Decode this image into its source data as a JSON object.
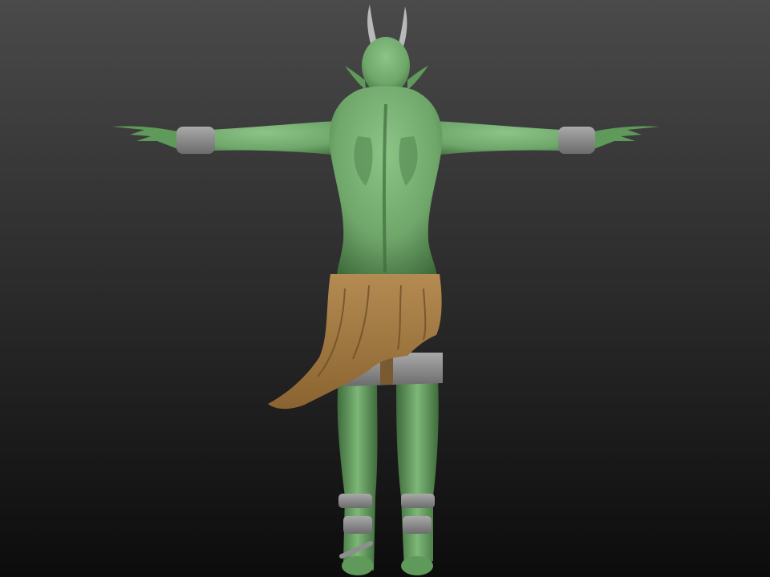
{
  "viewport": {
    "background_top": "#4a4a4a",
    "background_bottom": "#0c0c0c"
  },
  "model": {
    "subject": "green-creature-sculpt-back-view",
    "pose": "T-pose",
    "skin_color": "#6fa66a",
    "skin_shadow": "#3f6b3c",
    "horn_color": "#b9b9b9",
    "cloth_color": "#a47b45",
    "cloth_shadow": "#6e4f28",
    "wrap_color": "#8e8e8e"
  }
}
